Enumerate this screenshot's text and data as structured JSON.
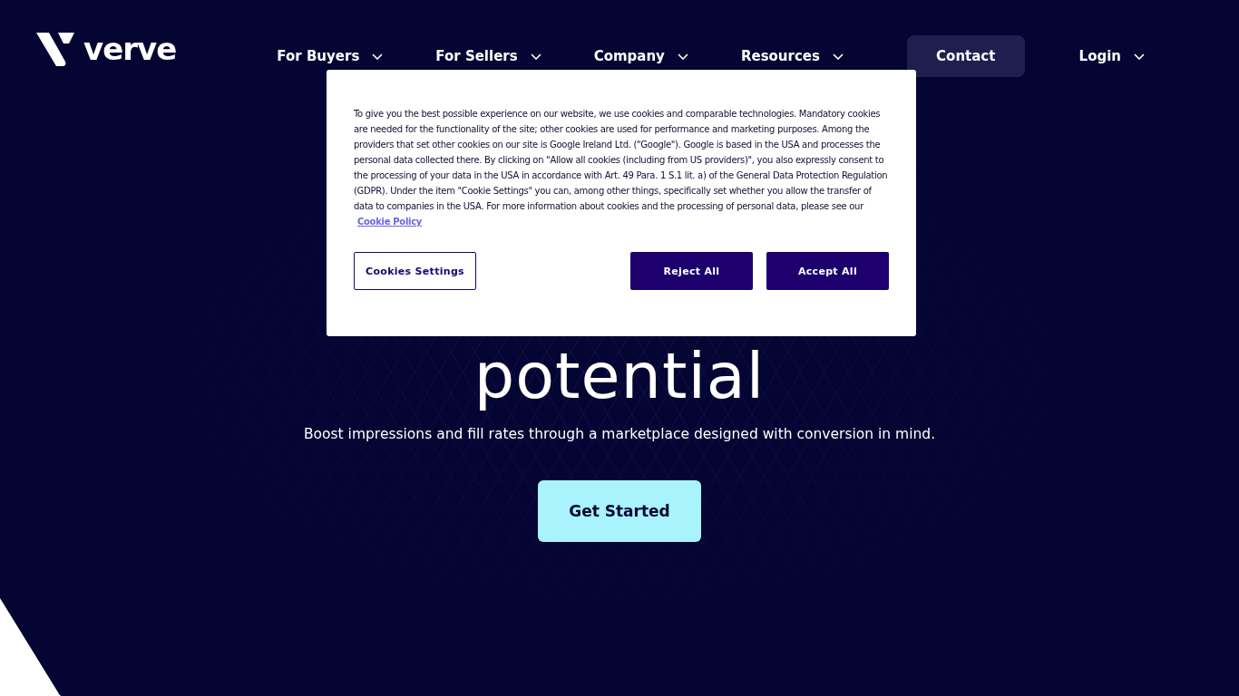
{
  "header": {
    "logo": "verve",
    "nav": [
      {
        "label": "For Buyers",
        "has_menu": true
      },
      {
        "label": "For Sellers",
        "has_menu": true
      },
      {
        "label": "Company",
        "has_menu": true
      },
      {
        "label": "Resources",
        "has_menu": true
      }
    ],
    "contact_button": "Contact",
    "login": {
      "label": "Login",
      "has_menu": true
    }
  },
  "hero": {
    "headline": "potential",
    "subtitle": "Boost impressions and fill rates through a marketplace designed with conversion in mind.",
    "cta": "Get Started"
  },
  "cookie_dialog": {
    "text": "To give you the best possible experience on our website, we use cookies and comparable technologies. Mandatory cookies are needed for the functionality of the site; other cookies are used for performance and marketing purposes. Among the providers that set other cookies on our site is Google Ireland Ltd. (\"Google\"). Google is based in the USA and processes the personal data collected there. By clicking on \"Allow all cookies (including from US providers)\", you also expressly consent to the processing of your data in the USA in accordance with Art. 49 Para. 1 S.1 lit. a) of the General Data Protection Regulation (GDPR). Under the item \"Cookie Settings\" you can, among other things, specifically set whether you allow the transfer of data to companies in the USA. For more information about cookies and the processing of personal data, please see our",
    "policy_link": "Cookie Policy",
    "buttons": [
      {
        "label": "Cookies Settings",
        "kind": "outline"
      },
      {
        "label": "Reject All",
        "kind": "filled"
      },
      {
        "label": "Accept All",
        "kind": "filled"
      }
    ]
  }
}
